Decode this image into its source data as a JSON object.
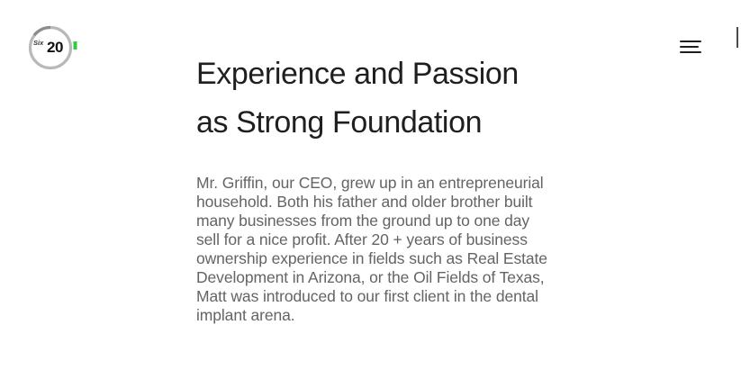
{
  "header": {
    "logo": {
      "brand_text": "Six",
      "brand_number": "20",
      "ring_color": "#b9b9b9",
      "accent_color": "#2ecc40"
    },
    "menu_icon": "hamburger-icon"
  },
  "section": {
    "headline_line1": "Experience and Passion",
    "headline_line2": "as Strong Foundation",
    "body": "Mr. Griffin, our CEO, grew up in an entrepreneurial household. Both his father and older brother built many businesses from the ground up to one day sell for a nice profit. After 20 + years of business ownership experience in fields such as Real Estate Development in Arizona, or the Oil Fields of Texas, Matt was introduced to our first client in the dental implant arena."
  },
  "colors": {
    "headline": "#1f1f1f",
    "body_text": "#646464",
    "background": "#ffffff"
  }
}
